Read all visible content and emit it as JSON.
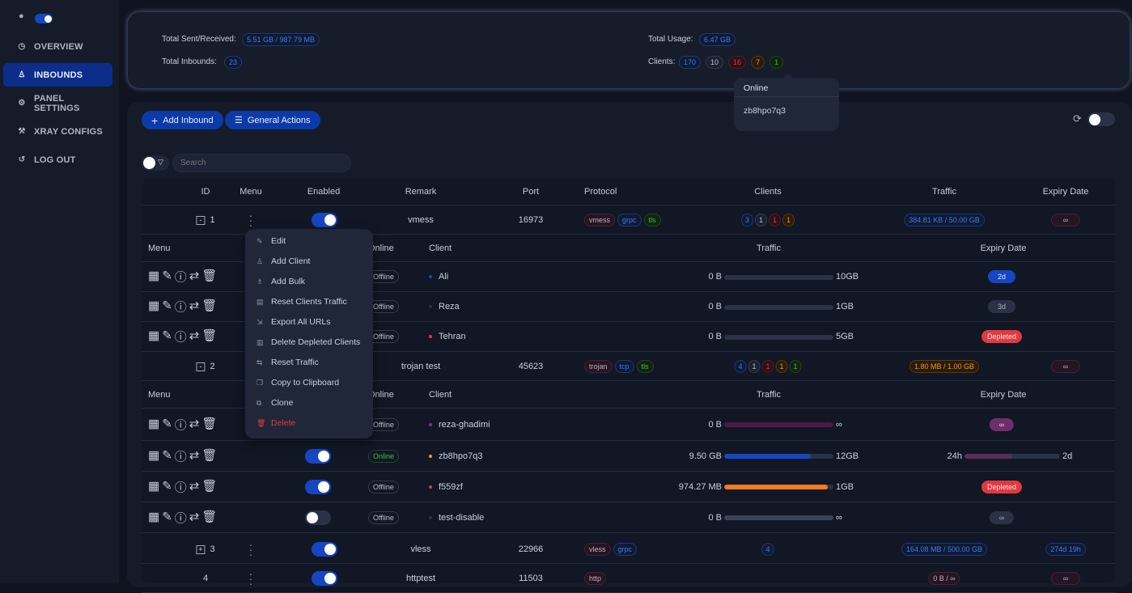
{
  "sidebar": {
    "theme_icon": "lightbulb-icon",
    "items": [
      {
        "label": "OVERVIEW",
        "icon": "dashboard-icon",
        "active": false
      },
      {
        "label": "INBOUNDS",
        "icon": "user-icon",
        "active": true
      },
      {
        "label": "PANEL SETTINGS",
        "icon": "gear-icon",
        "active": false
      },
      {
        "label": "XRAY CONFIGS",
        "icon": "tool-icon",
        "active": false
      },
      {
        "label": "LOG OUT",
        "icon": "logout-icon",
        "active": false
      }
    ]
  },
  "stats": {
    "sent_label": "Total Sent/Received:",
    "sent_value": "5.51 GB / 987.79 MB",
    "inbounds_label": "Total Inbounds:",
    "inbounds_value": "23",
    "usage_label": "Total Usage:",
    "usage_value": "6.47 GB",
    "clients_label": "Clients:",
    "clients_counts": [
      "170",
      "10",
      "16",
      "7",
      "1"
    ]
  },
  "tooltip": {
    "title": "Online",
    "items": [
      "zb8hpo7q3"
    ]
  },
  "toolbar": {
    "add_inbound": "Add Inbound",
    "general_actions": "General Actions",
    "search_placeholder": "Search"
  },
  "table": {
    "headers": [
      "ID",
      "Menu",
      "Enabled",
      "Remark",
      "Port",
      "Protocol",
      "Clients",
      "Traffic",
      "Expiry Date"
    ],
    "sub_headers": [
      "Menu",
      "Online",
      "Client",
      "Traffic",
      "Expiry Date"
    ]
  },
  "inbounds": [
    {
      "id": "1",
      "expanded": true,
      "enabled": true,
      "remark": "vmess",
      "port": "16973",
      "protocol": [
        [
          "vmess",
          "purple"
        ],
        [
          "grpc",
          ""
        ],
        [
          "tls",
          "green"
        ]
      ],
      "clients": [
        [
          "3",
          ""
        ],
        [
          "1",
          "gray"
        ],
        [
          "1",
          "red"
        ],
        [
          "1",
          "orange"
        ]
      ],
      "traffic": [
        "384.81 KB / 50.00 GB",
        ""
      ],
      "expiry": [
        "∞",
        "purple"
      ],
      "clients_list": [
        {
          "enabled": null,
          "online": "Offline",
          "name": "Ali",
          "dot": "#1646c4",
          "used": "0 B",
          "total": "10GB",
          "pct": 0,
          "bar": "#2a3345",
          "expiry": "2d",
          "expiry_style": "solid-blue"
        },
        {
          "enabled": null,
          "online": "Offline",
          "name": "Reza",
          "dot": "#2a3345",
          "used": "0 B",
          "total": "1GB",
          "pct": 0,
          "bar": "#2a3345",
          "expiry": "3d",
          "expiry_style": "solid-gray"
        },
        {
          "enabled": null,
          "online": "Offline",
          "name": "Tehran",
          "dot": "#e03a3e",
          "used": "0 B",
          "total": "5GB",
          "pct": 0,
          "bar": "#2a3345",
          "expiry": "Depleted",
          "expiry_style": "solid-red"
        }
      ]
    },
    {
      "id": "2",
      "expanded": true,
      "enabled": null,
      "remark": "trojan test",
      "port": "45623",
      "protocol": [
        [
          "trojan",
          "purple"
        ],
        [
          "tcp",
          ""
        ],
        [
          "tls",
          "green"
        ]
      ],
      "clients": [
        [
          "4",
          ""
        ],
        [
          "1",
          "gray"
        ],
        [
          "1",
          "red"
        ],
        [
          "1",
          "orange"
        ],
        [
          "1",
          "green"
        ]
      ],
      "traffic": [
        "1.80 MB / 1.00 GB",
        "orange"
      ],
      "expiry": [
        "∞",
        "purple"
      ],
      "clients_list": [
        {
          "enabled": null,
          "online": "Offline",
          "name": "reza-ghadimi",
          "dot": "#8a2f7a",
          "used": "0 B",
          "total": "∞",
          "pct": 0,
          "bar": "#4a1a42",
          "expiry": "∞",
          "expiry_style": "solid-purple"
        },
        {
          "enabled": true,
          "online": "Online",
          "name": "zb8hpo7q3",
          "dot": "#f0922a",
          "used": "9.50 GB",
          "total": "12GB",
          "pct": 79,
          "bar": "#1646c4",
          "expiry_from": "24h",
          "expiry_to": "2d",
          "expiry_pct": 50
        },
        {
          "enabled": true,
          "online": "Offline",
          "name": "f559zf",
          "dot": "#e03a3e",
          "used": "974.27 MB",
          "total": "1GB",
          "pct": 95,
          "bar": "#f57a20",
          "expiry": "Depleted",
          "expiry_style": "solid-red"
        },
        {
          "enabled": false,
          "online": "Offline",
          "name": "test-disable",
          "dot": "#2a3345",
          "used": "0 B",
          "total": "∞",
          "pct": 0,
          "bar": "#3a4356",
          "expiry": "∞",
          "expiry_style": "solid-gray"
        }
      ]
    },
    {
      "id": "3",
      "expanded": false,
      "enabled": true,
      "remark": "vless",
      "port": "22966",
      "protocol": [
        [
          "vless",
          "purple"
        ],
        [
          "grpc",
          ""
        ]
      ],
      "clients": [
        [
          "4",
          ""
        ]
      ],
      "traffic": [
        "164.08 MB / 500.00 GB",
        ""
      ],
      "expiry": [
        "274d 19h",
        ""
      ]
    },
    {
      "id": "4",
      "expanded": null,
      "enabled": true,
      "remark": "httptest",
      "port": "11503",
      "protocol": [
        [
          "http",
          "purple"
        ]
      ],
      "clients": [],
      "traffic": [
        "0 B / ∞",
        "purple"
      ],
      "expiry": [
        "∞",
        "purple"
      ]
    }
  ],
  "row_menu": [
    {
      "label": "Edit",
      "icon": "edit-icon"
    },
    {
      "label": "Add Client",
      "icon": "user-add-icon"
    },
    {
      "label": "Add Bulk",
      "icon": "users-add-icon"
    },
    {
      "label": "Reset Clients Traffic",
      "icon": "file-reset-icon"
    },
    {
      "label": "Export All URLs",
      "icon": "export-icon"
    },
    {
      "label": "Delete Depleted Clients",
      "icon": "trash-icon"
    },
    {
      "label": "Reset Traffic",
      "icon": "reload-icon"
    },
    {
      "label": "Copy to Clipboard",
      "icon": "copy-icon"
    },
    {
      "label": "Clone",
      "icon": "clone-icon"
    },
    {
      "label": "Delete",
      "icon": "delete-icon",
      "danger": true
    }
  ],
  "colors": {
    "accent": "#1646c4",
    "danger": "#e03a3e",
    "success": "#4cba4c",
    "warning": "#f0922a"
  }
}
